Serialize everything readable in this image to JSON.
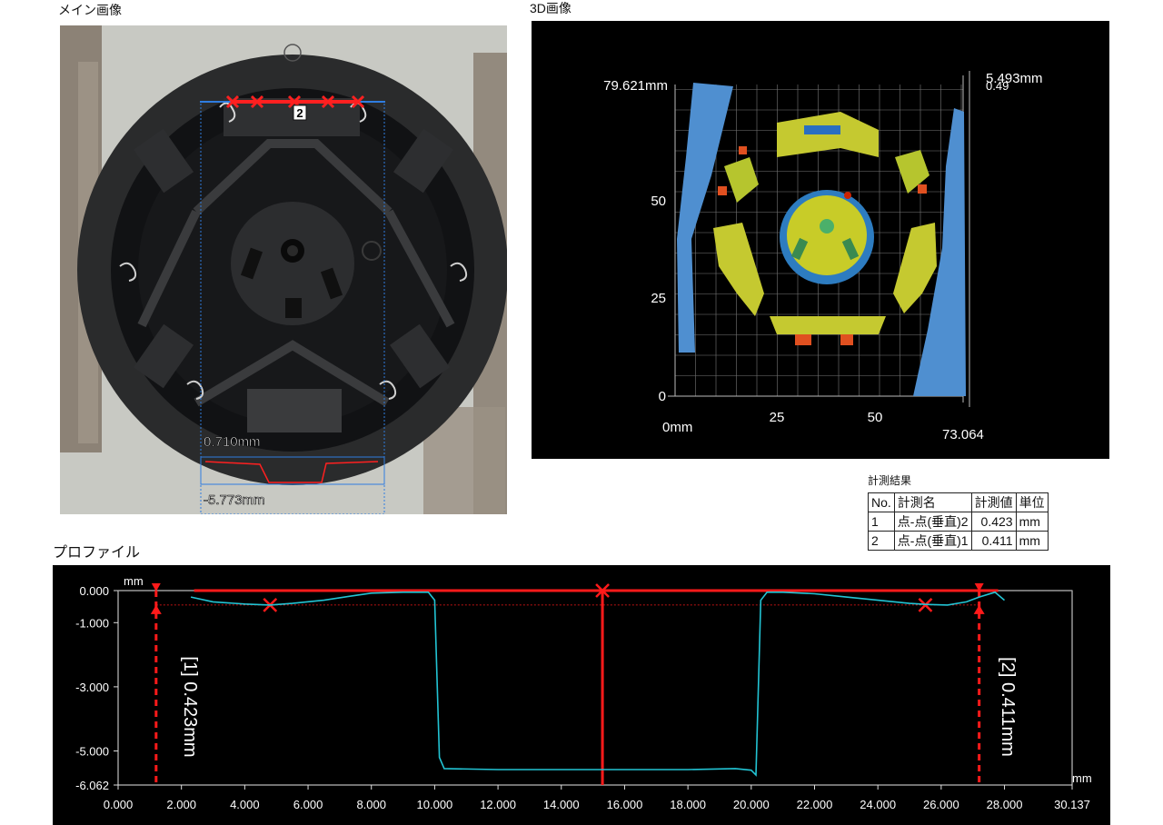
{
  "main_image": {
    "title": "メイン画像",
    "label_box": "2",
    "dim_top": "0.710mm",
    "dim_bottom": "-5.773mm"
  },
  "view3d": {
    "title": "3D画像",
    "top_left": "79.621mm",
    "top_right_a": "5.493mm",
    "top_right_b": "0.49",
    "y_tick_50": "50",
    "y_tick_25": "25",
    "y_tick_0": "0",
    "x_origin": "0mm",
    "x_tick_25": "25",
    "x_tick_50": "50",
    "x_max": "73.064"
  },
  "results": {
    "title": "計測結果",
    "headers": [
      "No.",
      "計測名",
      "計測値",
      "単位"
    ],
    "rows": [
      {
        "no": "1",
        "name": "点-点(垂直)2",
        "value": "0.423",
        "unit": "mm"
      },
      {
        "no": "2",
        "name": "点-点(垂直)1",
        "value": "0.411",
        "unit": "mm"
      }
    ]
  },
  "profile": {
    "title": "プロファイル",
    "unit_y": "mm",
    "unit_x": "mm",
    "y_ticks": [
      "0.000",
      "-1.000",
      "-3.000",
      "-5.000",
      "-6.062"
    ],
    "x_ticks": [
      "0.000",
      "2.000",
      "4.000",
      "6.000",
      "8.000",
      "10.000",
      "12.000",
      "14.000",
      "16.000",
      "18.000",
      "20.000",
      "22.000",
      "24.000",
      "26.000",
      "28.000",
      "30.137"
    ],
    "meas1_label": "[1] 0.423mm",
    "meas2_label": "[2] 0.411mm"
  },
  "chart_data": {
    "type": "line",
    "x_range": [
      0.0,
      30.137
    ],
    "y_range": [
      -6.062,
      0.0
    ],
    "series": [
      {
        "x": [
          2.3,
          3.0,
          4.0,
          4.8,
          5.5,
          6.5,
          7.5,
          8.0,
          9.0,
          9.8,
          10.0,
          10.15,
          10.3,
          12.0,
          14.0,
          16.0,
          18.0,
          19.5,
          20.0,
          20.15,
          20.3,
          20.5,
          21.0,
          22.0,
          23.0,
          24.0,
          25.0,
          25.5,
          26.2,
          26.8,
          27.2,
          27.7,
          28.0
        ],
        "y": [
          -0.2,
          -0.35,
          -0.42,
          -0.45,
          -0.4,
          -0.3,
          -0.15,
          -0.08,
          -0.05,
          -0.05,
          -0.3,
          -5.2,
          -5.55,
          -5.58,
          -5.58,
          -5.58,
          -5.58,
          -5.55,
          -5.6,
          -5.75,
          -0.3,
          -0.05,
          -0.05,
          -0.1,
          -0.2,
          -0.3,
          -0.4,
          -0.43,
          -0.45,
          -0.35,
          -0.2,
          -0.05,
          -0.3
        ]
      }
    ]
  }
}
